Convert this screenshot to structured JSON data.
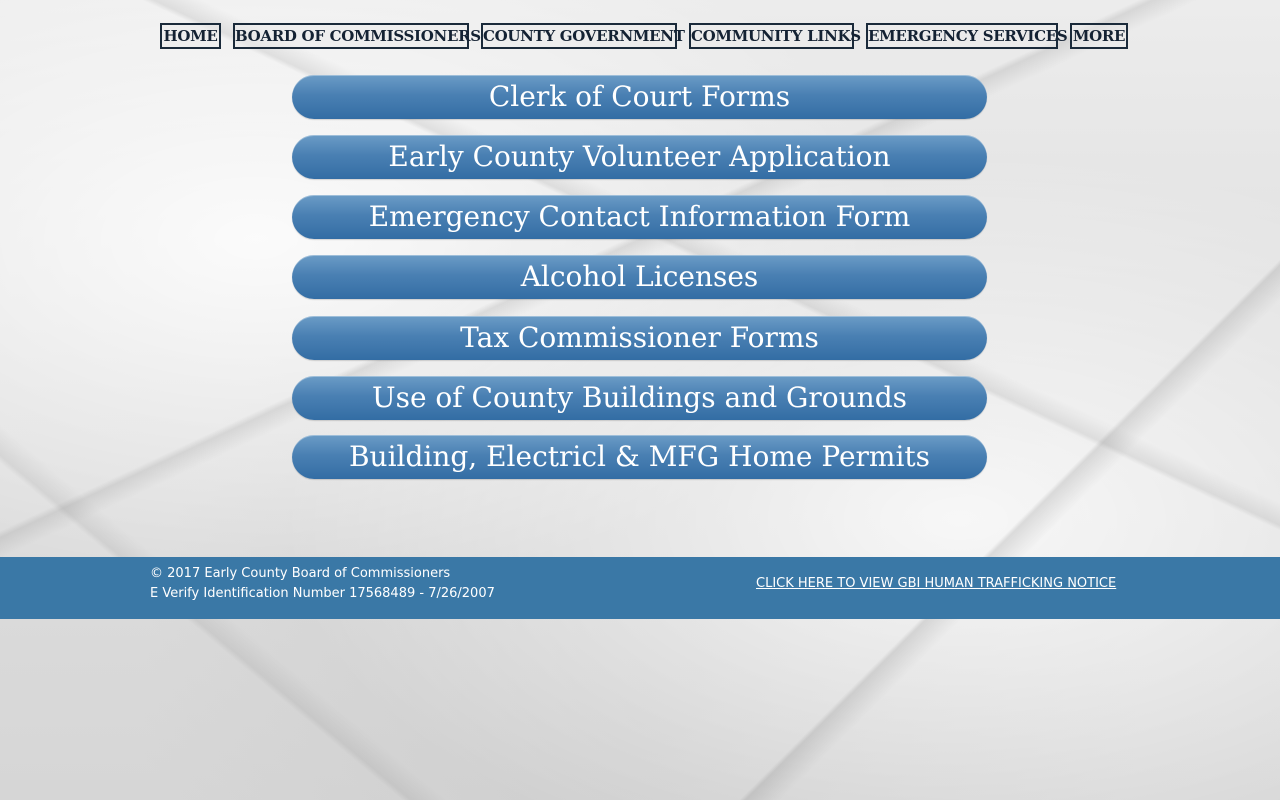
{
  "nav": {
    "items": [
      {
        "label": "HOME"
      },
      {
        "label": "BOARD OF COMMISSIONERS"
      },
      {
        "label": "COUNTY GOVERNMENT"
      },
      {
        "label": "COMMUNITY LINKS"
      },
      {
        "label": "EMERGENCY SERVICES"
      },
      {
        "label": "MORE"
      }
    ]
  },
  "forms": {
    "buttons": [
      {
        "label": "Clerk of Court Forms"
      },
      {
        "label": "Early County Volunteer Application"
      },
      {
        "label": "Emergency Contact Information Form"
      },
      {
        "label": "Alcohol Licenses"
      },
      {
        "label": "Tax Commissioner Forms"
      },
      {
        "label": "Use of County Buildings and Grounds"
      },
      {
        "label": "Building, Electricl & MFG Home Permits"
      }
    ],
    "button_color": "#4a80b3"
  },
  "footer": {
    "copyright": "© 2017 Early County Board of Commissioners",
    "everify": "E Verify Identification Number 17568489 - 7/26/2007",
    "gbi_link": "CLICK HERE TO VIEW GBI HUMAN TRAFFICKING NOTICE",
    "bg_color": "#3a78a6"
  }
}
